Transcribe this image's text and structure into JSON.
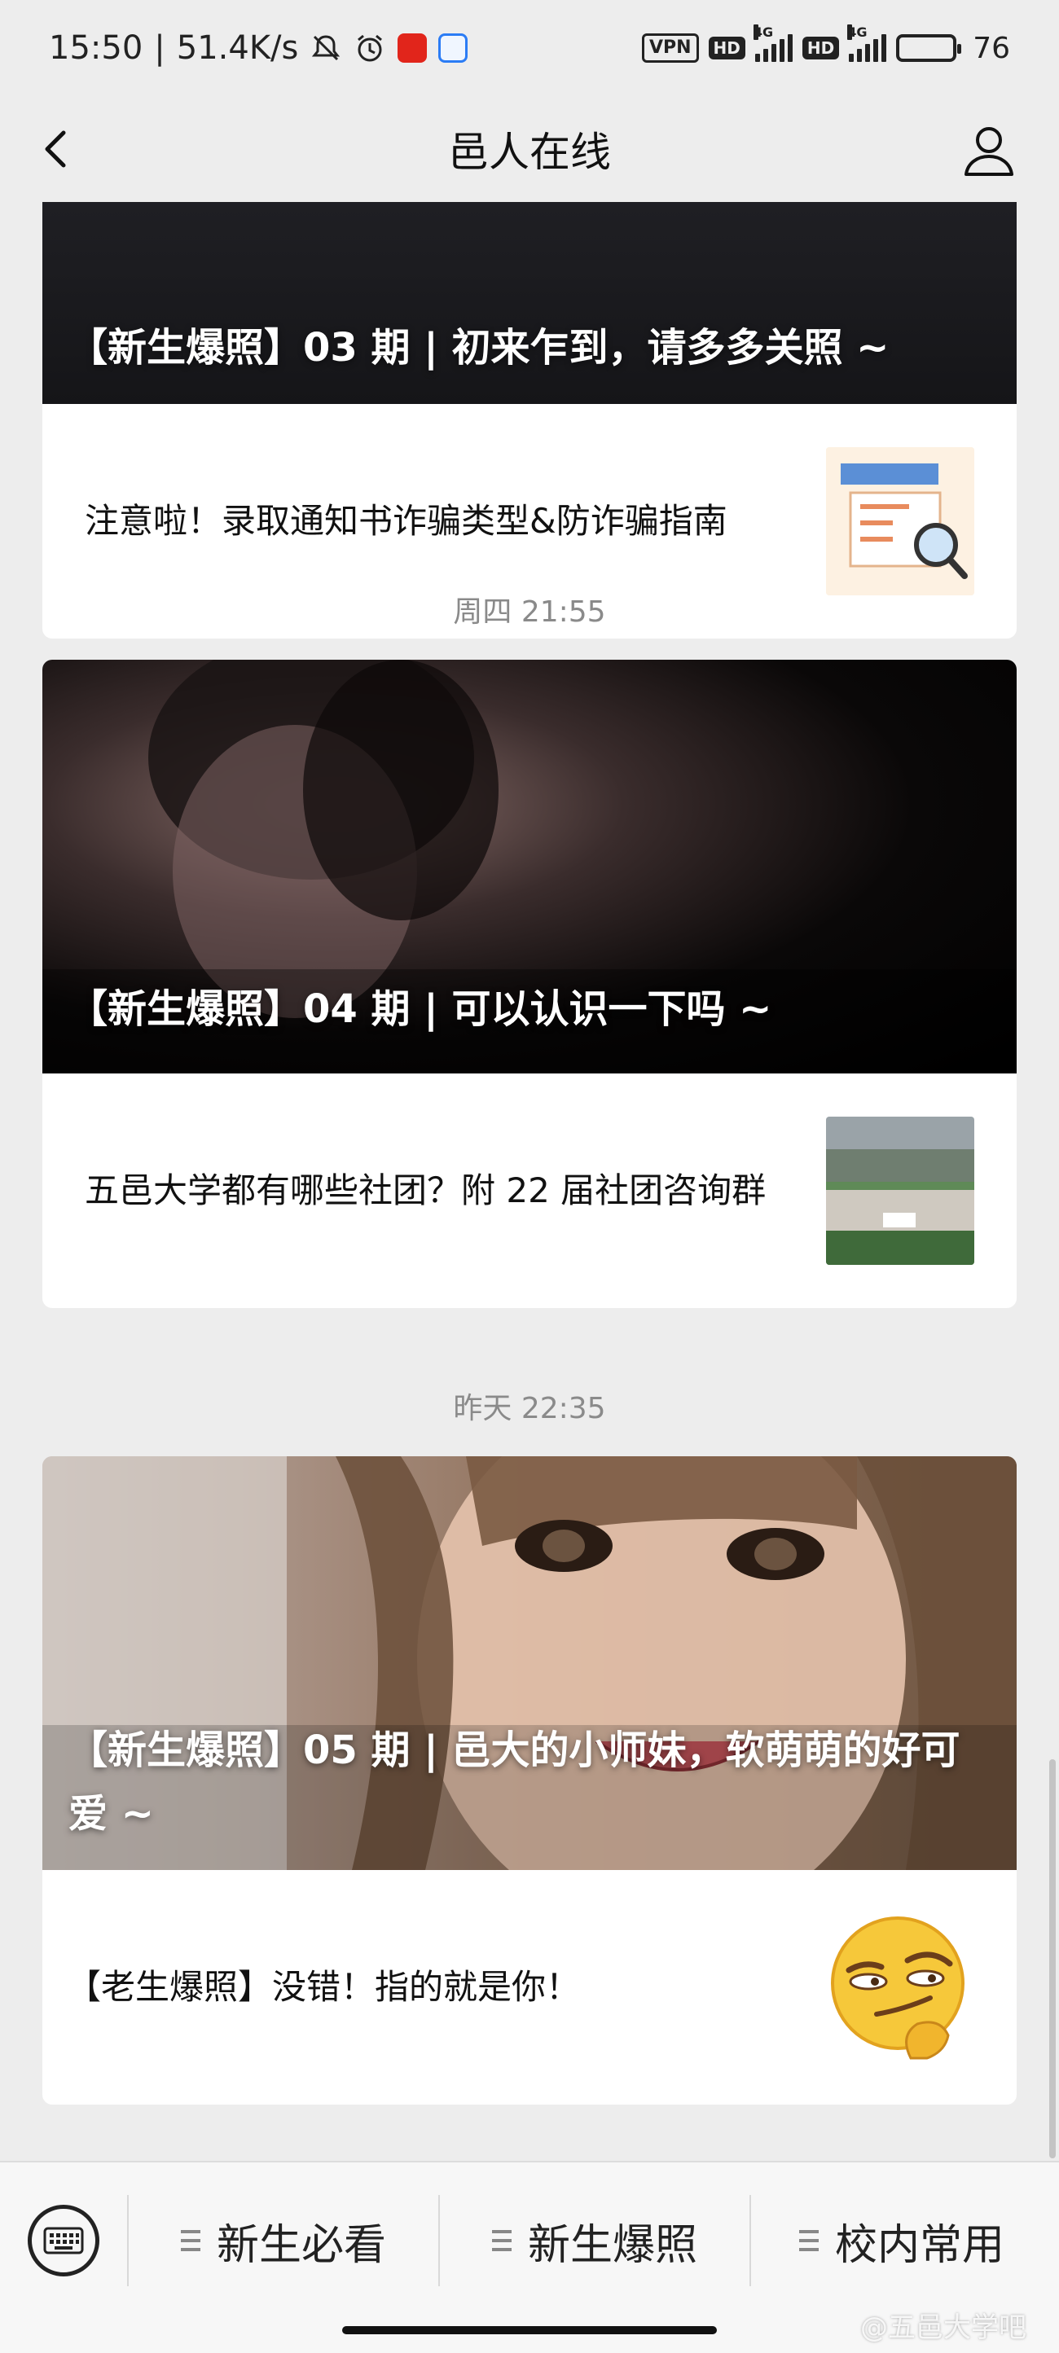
{
  "status_bar": {
    "time": "15:50",
    "net_speed": "51.4K/s",
    "vpn": "VPN",
    "hd": "HD",
    "net_type": "4G",
    "battery": "76",
    "battery_level": 0.76
  },
  "nav": {
    "title": "邑人在线"
  },
  "feed": {
    "card1": {
      "cover_title": "【新生爆照】03 期 | 初来乍到，请多多关照 ~",
      "sub_title": "注意啦！录取通知书诈骗类型&防诈骗指南"
    },
    "time2": "周四 21:55",
    "card2": {
      "cover_title": "【新生爆照】04 期 | 可以认识一下吗 ~",
      "sub_title": "五邑大学都有哪些社团？附 22 届社团咨询群"
    },
    "time3": "昨天 22:35",
    "card3": {
      "cover_title": "【新生爆照】05 期 | 邑大的小师妹，软萌萌的好可爱 ~",
      "sub_title": "【老生爆照】没错！指的就是你！"
    }
  },
  "menu": {
    "items": [
      {
        "label": "新生必看"
      },
      {
        "label": "新生爆照"
      },
      {
        "label": "校内常用"
      }
    ]
  },
  "watermark": "@五邑大学吧",
  "colors": {
    "background": "#ededed",
    "card": "#ffffff",
    "timestamp": "#8a8a8a"
  }
}
